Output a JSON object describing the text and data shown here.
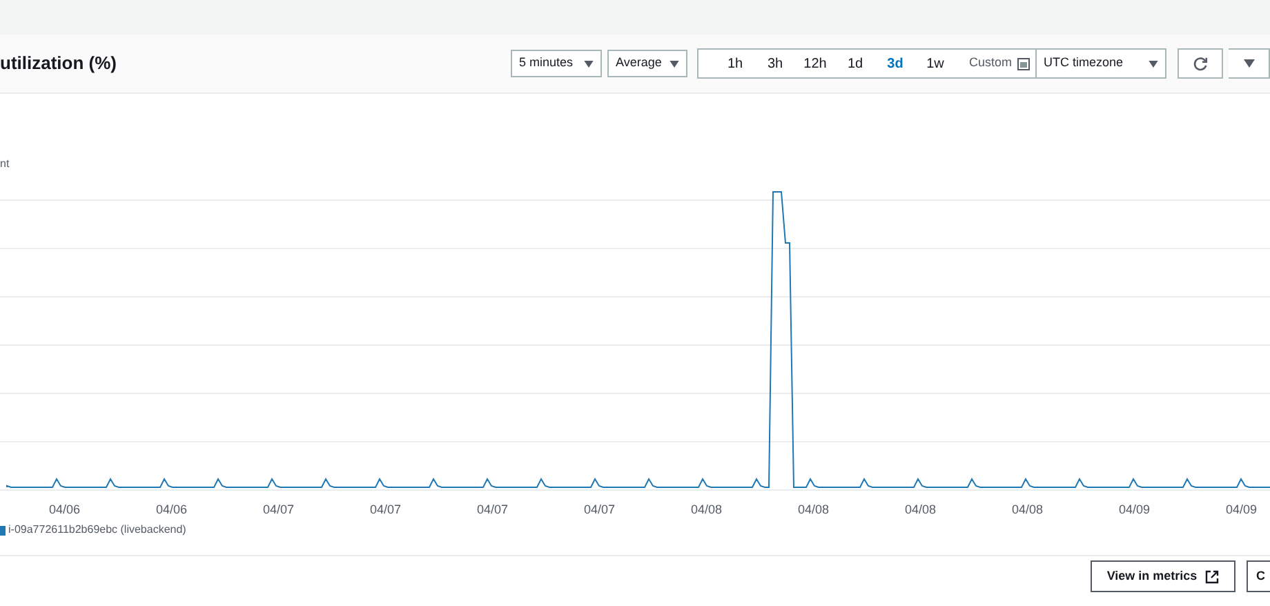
{
  "widget": {
    "title": "utilization (%)"
  },
  "controls": {
    "period": "5 minutes",
    "statistic": "Average",
    "ranges": [
      {
        "label": "1h",
        "selected": false
      },
      {
        "label": "3h",
        "selected": false
      },
      {
        "label": "12h",
        "selected": false
      },
      {
        "label": "1d",
        "selected": false
      },
      {
        "label": "3d",
        "selected": true
      },
      {
        "label": "1w",
        "selected": false
      }
    ],
    "custom": "Custom",
    "timezone": "UTC timezone"
  },
  "chart": {
    "y_label": "nt",
    "x_labels": [
      "04/06",
      "04/06",
      "04/07",
      "04/07",
      "04/07",
      "04/07",
      "04/08",
      "04/08",
      "04/08",
      "04/08",
      "04/09",
      "04/09"
    ],
    "legend": [
      {
        "label": "i-09a772611b2b69ebc (livebackend)",
        "color": "#1f77b4"
      }
    ]
  },
  "buttons": [
    {
      "label": "View in metrics",
      "kind": "external"
    },
    {
      "label": "C",
      "kind": "plain"
    }
  ]
}
